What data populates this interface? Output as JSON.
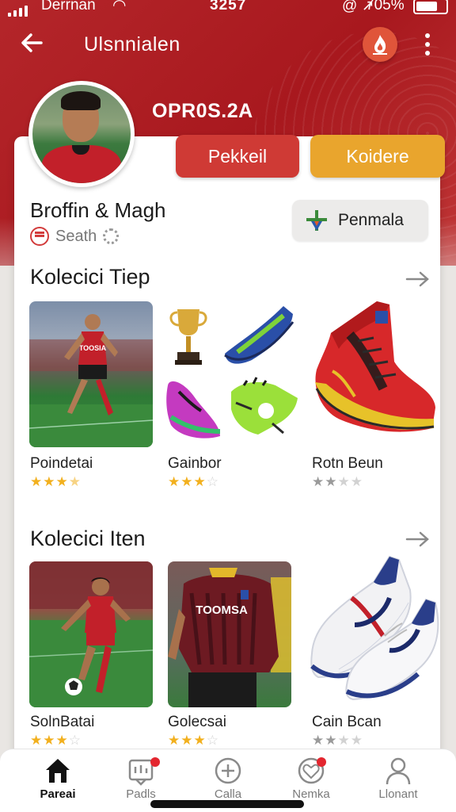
{
  "status_bar": {
    "carrier": "Derrnan",
    "time": "3257",
    "battery": "705%"
  },
  "app_bar": {
    "title": "Ulsnnialen"
  },
  "profile": {
    "code": "OPR0S.2A",
    "button_primary": "Pekkeil",
    "button_secondary": "Koidere",
    "name": "Broffin & Magh",
    "club": "Seath",
    "badge_label": "Penmala"
  },
  "sections": [
    {
      "title": "Kolecici Tiep",
      "items": [
        {
          "label": "Poindetai",
          "rating": 3.5
        },
        {
          "label": "Gainbor",
          "rating": 3.5
        },
        {
          "label": "Rotn Beun",
          "rating": 2
        }
      ]
    },
    {
      "title": "Kolecici Iten",
      "items": [
        {
          "label": "SolnBatai",
          "rating": 3.5
        },
        {
          "label": "Golecsai",
          "rating": 3.5
        },
        {
          "label": "Cain Bcan",
          "rating": 2
        }
      ]
    }
  ],
  "jersey_text": "TOOSIA",
  "jersey_text_2": "TOOMSA",
  "bottom_nav": [
    {
      "label": "Pareai",
      "icon": "home-icon",
      "active": true
    },
    {
      "label": "Padls",
      "icon": "chat-icon",
      "badge": true
    },
    {
      "label": "Calla",
      "icon": "add-icon"
    },
    {
      "label": "Nemka",
      "icon": "heart-icon",
      "badge": true
    },
    {
      "label": "Llonant",
      "icon": "profile-icon"
    }
  ],
  "colors": {
    "brand_red": "#b4262a",
    "button_red": "#cf3a35",
    "button_yellow": "#e9a52d",
    "star": "#f2b01e"
  }
}
